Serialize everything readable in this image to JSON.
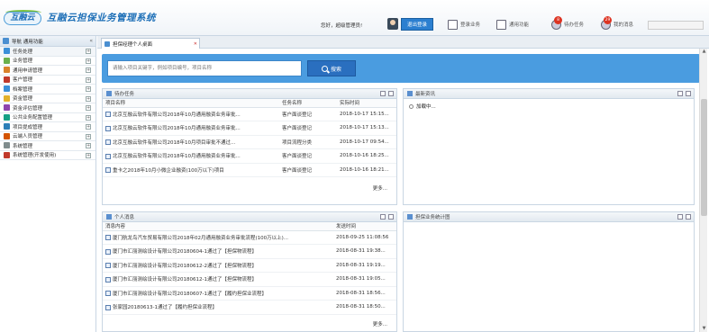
{
  "header": {
    "logo_text": "互融云",
    "system_title": "互融云担保业务管理系统",
    "greeting": "您好，超级管理员!",
    "logout_label": "退出登录",
    "links": [
      {
        "label": "登录业务",
        "icon": "monitor-icon"
      },
      {
        "label": "通用功能",
        "icon": "edit-icon"
      },
      {
        "label": "待办任务",
        "icon": "task-icon",
        "badge": "8"
      },
      {
        "label": "我的消息",
        "icon": "message-icon",
        "badge": "29"
      }
    ]
  },
  "sidebar": {
    "title": "导航 通用功能",
    "items": [
      {
        "label": "任务处理",
        "color": "#3a8fd8"
      },
      {
        "label": "业务管理",
        "color": "#6ab04c"
      },
      {
        "label": "通用申请管理",
        "color": "#d9822b"
      },
      {
        "label": "客户管理",
        "color": "#c0392b"
      },
      {
        "label": "档案管理",
        "color": "#3a8fd8"
      },
      {
        "label": "资金管理",
        "color": "#e1b12c"
      },
      {
        "label": "资金评估管理",
        "color": "#8e44ad"
      },
      {
        "label": "公共业务配置管理",
        "color": "#16a085"
      },
      {
        "label": "项目提成管理",
        "color": "#2c7fb8"
      },
      {
        "label": "云端人员管理",
        "color": "#d35400"
      },
      {
        "label": "系统管理",
        "color": "#7f8c8d"
      },
      {
        "label": "系统管理(开发使用)",
        "color": "#c0392b"
      }
    ]
  },
  "tab": {
    "label": "担保经理个人桌面"
  },
  "search": {
    "placeholder": "请输入项目关键字，例如项目编号，项目名称",
    "button_label": "搜索"
  },
  "tasks_panel": {
    "title": "待办任务",
    "columns": [
      "项目名称",
      "任务名称",
      "实际时间"
    ],
    "rows": [
      {
        "name": "北京互融云软件有限公司2018年10月通用融资业务审批...",
        "task": "客户面谈登记",
        "time": "2018-10-17 15:15..."
      },
      {
        "name": "北京互融云软件有限公司2018年10月通用融资业务审批...",
        "task": "客户面谈登记",
        "time": "2018-10-17 15:13..."
      },
      {
        "name": "北京互融云软件有限公司2018年10月项目审批不通过...",
        "task": "项目流程分类",
        "time": "2018-10-17 09:54..."
      },
      {
        "name": "北京互融云软件有限公司2018年10月通用融资业务审批...",
        "task": "客户面谈登记",
        "time": "2018-10-16 18:25..."
      },
      {
        "name": "重卡之2018年10月小微企业融资(100万以下)项目",
        "task": "客户面谈登记",
        "time": "2018-10-16 18:21..."
      }
    ],
    "more": "更多..."
  },
  "news_panel": {
    "title": "最新资讯",
    "loading": "加载中..."
  },
  "messages_panel": {
    "title": "个人消息",
    "columns": [
      "消息内容",
      "发送时间"
    ],
    "rows": [
      {
        "content": "厦门航龙鸟汽车贸易有限公司2018年02月通用融资业务审批流程(100万以上)...",
        "time": "2018-09-25 11:08:56"
      },
      {
        "content": "厦门市汇丽测绘设计有限公司20180604-1通过了【担保物流程】",
        "time": "2018-08-31 19:38..."
      },
      {
        "content": "厦门市汇丽测绘设计有限公司20180612-2通过了【担保物流程】",
        "time": "2018-08-31 19:19..."
      },
      {
        "content": "厦门市汇丽测绘设计有限公司20180612-1通过了【担保物流程】",
        "time": "2018-08-31 19:05..."
      },
      {
        "content": "厦门市汇丽测绘设计有限公司20180607-1通过了【履约担保业流程】",
        "time": "2018-08-31 18:56..."
      },
      {
        "content": "张家园20180613-1通过了【履约担保业流程】",
        "time": "2018-08-31 18:50..."
      }
    ],
    "more": "更多..."
  },
  "stats_panel": {
    "title": "担保业务统计图"
  }
}
